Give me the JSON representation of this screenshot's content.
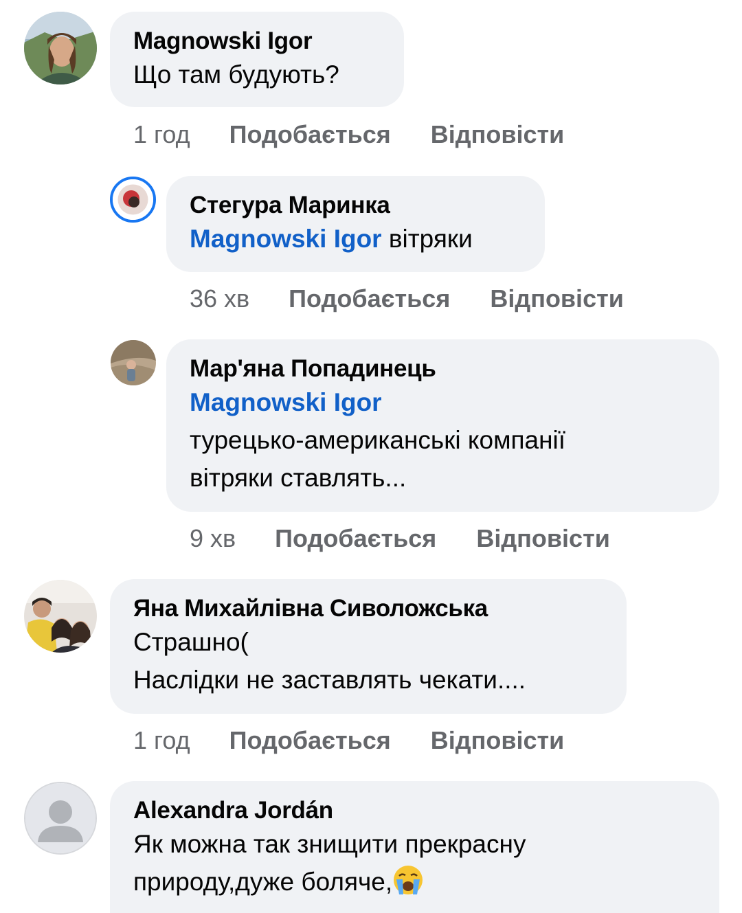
{
  "comments": [
    {
      "author": "Magnowski Igor",
      "text": "Що там будують?",
      "time": "1 год",
      "like": "Подобається",
      "reply": "Відповісти"
    },
    {
      "author": "Стегура Маринка",
      "mention": "Magnowski Igor",
      "text": "вітряки",
      "time": "36 хв",
      "like": "Подобається",
      "reply": "Відповісти"
    },
    {
      "author": "Мар'яна Попадинець",
      "mention": "Magnowski Igor",
      "text_line1": "турецько-американські компанії",
      "text_line2": "вітряки ставлять...",
      "time": "9 хв",
      "like": "Подобається",
      "reply": "Відповісти"
    },
    {
      "author": "Яна Михайлівна Сиволожська",
      "text_line1": "Страшно(",
      "text_line2": "Наслідки не заставлять чекати....",
      "time": "1 год",
      "like": "Подобається",
      "reply": "Відповісти"
    },
    {
      "author": "Alexandra Jordán",
      "text_line1": "Як можна так знищити прекрасну",
      "text_line2": "природу,дуже боляче,",
      "emoji": "crying-face"
    }
  ],
  "colors": {
    "bubble": "#f0f2f5",
    "mention": "#1160c8",
    "meta": "#65676b",
    "story_ring": "#1877f2"
  }
}
